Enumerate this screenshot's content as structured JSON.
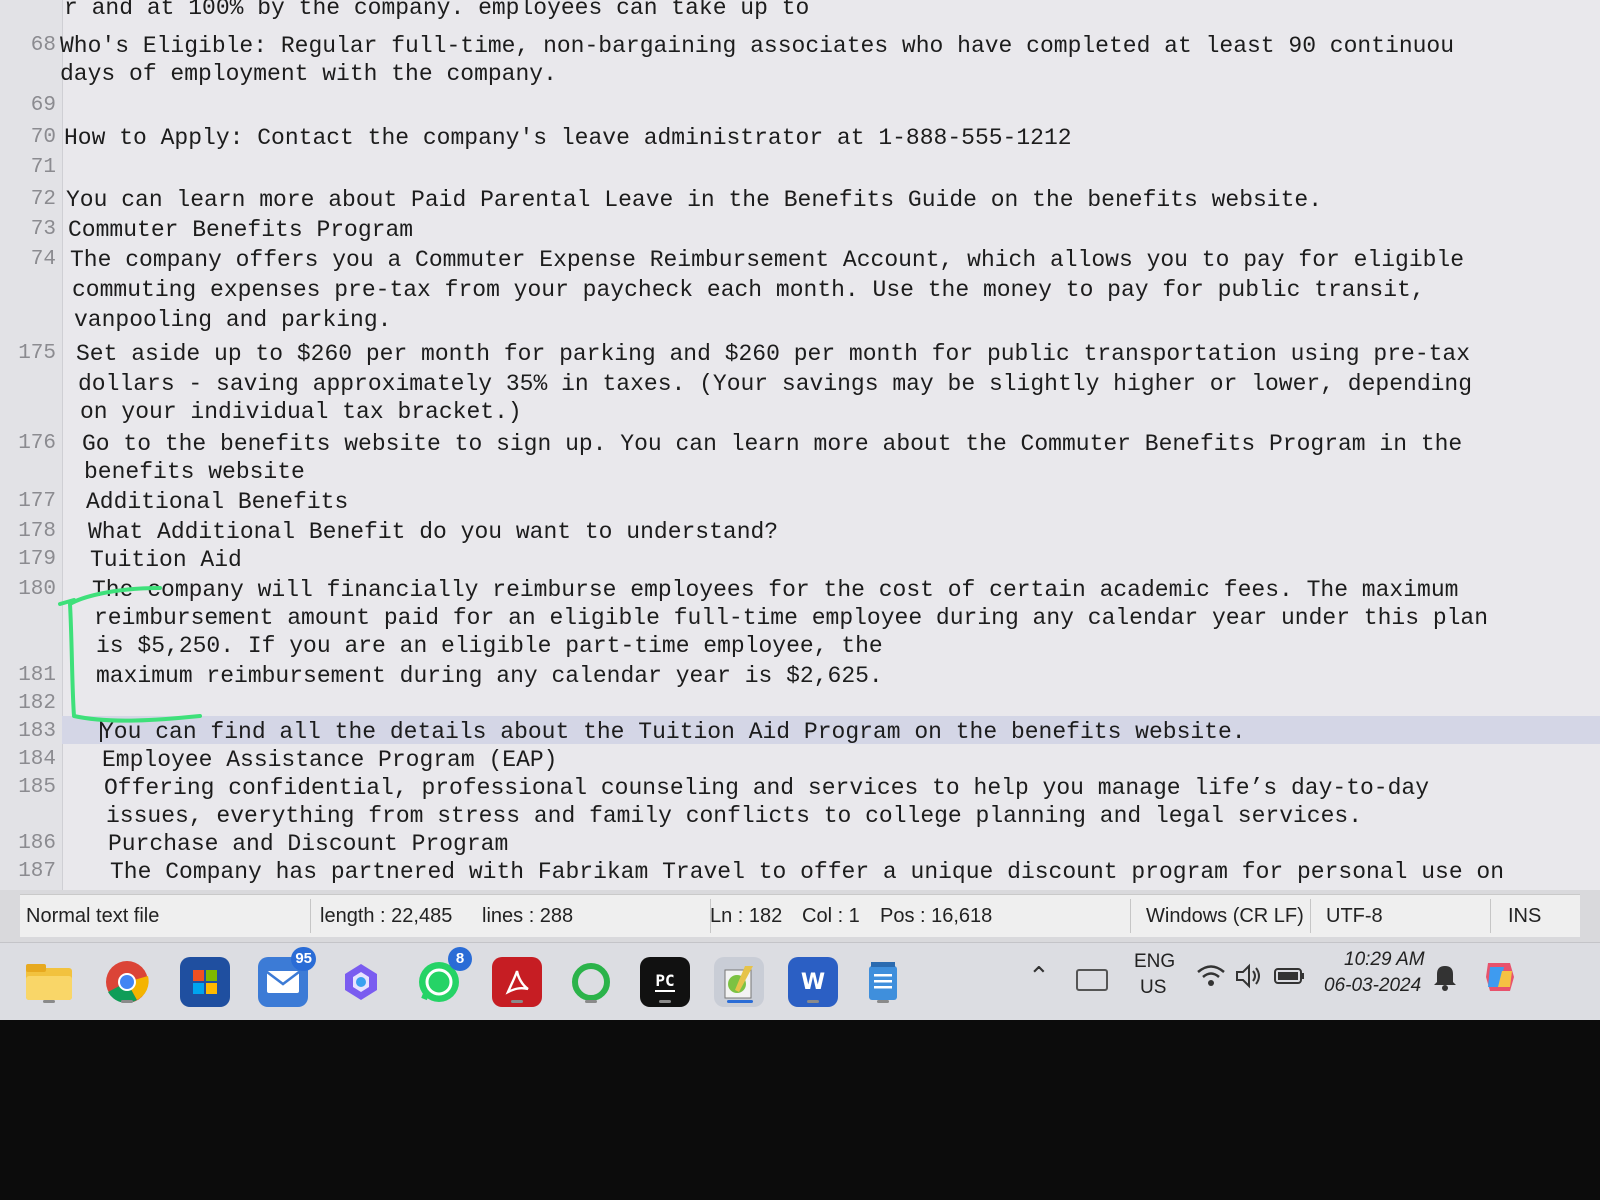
{
  "editor": {
    "lines": [
      {
        "num": "",
        "text": "                            r and at 100% by the company.                              employees can take up to"
      },
      {
        "num": "68",
        "text": "Who's Eligible: Regular full-time, non-bargaining associates who have completed at least 90 continuou"
      },
      {
        "num": "",
        "text": "days of employment with the company."
      },
      {
        "num": "69",
        "text": ""
      },
      {
        "num": "70",
        "text": "How to Apply: Contact the company's leave administrator at 1-888-555-1212"
      },
      {
        "num": "71",
        "text": ""
      },
      {
        "num": "72",
        "text": "You can learn more about Paid Parental Leave in the Benefits Guide on the benefits website."
      },
      {
        "num": "73",
        "text": "Commuter Benefits Program"
      },
      {
        "num": "74",
        "text": "The company offers you a Commuter Expense Reimbursement Account, which allows you to pay for eligible"
      },
      {
        "num": "",
        "text": "commuting expenses pre-tax from your paycheck each month. Use the money to pay for public transit,"
      },
      {
        "num": "",
        "text": "vanpooling and parking."
      },
      {
        "num": "175",
        "text": "Set aside up to $260 per month for parking and $260 per month for public transportation using pre-tax"
      },
      {
        "num": "",
        "text": "dollars - saving approximately 35% in taxes.  (Your savings may be slightly higher or lower, depending"
      },
      {
        "num": "",
        "text": "on your individual tax bracket.)"
      },
      {
        "num": "176",
        "text": "Go to the benefits website to sign up. You can learn more about the Commuter Benefits Program in the"
      },
      {
        "num": "",
        "text": "benefits website"
      },
      {
        "num": "177",
        "text": "Additional Benefits"
      },
      {
        "num": "178",
        "text": "What Additional Benefit do you want to understand?"
      },
      {
        "num": "179",
        "text": "Tuition Aid"
      },
      {
        "num": "180",
        "text": "The company will financially reimburse employees for the cost of certain academic fees. The maximum"
      },
      {
        "num": "",
        "text": "reimbursement amount paid for an eligible full-time employee during any calendar year under this plan"
      },
      {
        "num": "",
        "text": "is $5,250. If you are an eligible part-time employee, the"
      },
      {
        "num": "181",
        "text": "maximum reimbursement during any calendar year is $2,625."
      },
      {
        "num": "182",
        "text": ""
      },
      {
        "num": "183",
        "text": "You can find all the details about the Tuition Aid Program on the benefits website."
      },
      {
        "num": "184",
        "text": "Employee Assistance Program (EAP)"
      },
      {
        "num": "185",
        "text": "Offering confidential, professional counseling and services to help you manage life’s day-to-day"
      },
      {
        "num": "",
        "text": "issues, everything from stress and family conflicts to college planning and legal services."
      },
      {
        "num": "186",
        "text": "Purchase and Discount Program"
      },
      {
        "num": "187",
        "text": "The Company has partnered with Fabrikam Travel to offer a unique discount program for personal use on"
      }
    ]
  },
  "statusbar": {
    "file_type": "Normal text file",
    "length": "length : 22,485",
    "lines": "lines : 288",
    "ln": "Ln : 182",
    "col": "Col : 1",
    "pos": "Pos : 16,618",
    "eol": "Windows (CR LF)",
    "encoding": "UTF-8",
    "mode": "INS"
  },
  "taskbar": {
    "apps": [
      {
        "icon": "file-explorer-icon",
        "badge": ""
      },
      {
        "icon": "chrome-icon",
        "badge": ""
      },
      {
        "icon": "microsoft-store-icon",
        "badge": ""
      },
      {
        "icon": "mail-icon",
        "badge": "95"
      },
      {
        "icon": "copilot-icon",
        "badge": ""
      },
      {
        "icon": "whatsapp-icon",
        "badge": "8"
      },
      {
        "icon": "acrobat-icon",
        "badge": ""
      },
      {
        "icon": "ring-app-icon",
        "badge": ""
      },
      {
        "icon": "pycharm-icon",
        "badge": "",
        "label": "PC"
      },
      {
        "icon": "notepad-plus-plus-icon",
        "badge": ""
      },
      {
        "icon": "word-icon",
        "badge": "",
        "label": "W"
      },
      {
        "icon": "notepad-icon",
        "badge": ""
      }
    ],
    "tray": {
      "lang_top": "ENG",
      "lang_bottom": "US",
      "time": "10:29 AM",
      "date": "06-03-2024"
    }
  },
  "colors": {
    "annotation": "#3ee07a",
    "badge": "#2a6cd6"
  }
}
